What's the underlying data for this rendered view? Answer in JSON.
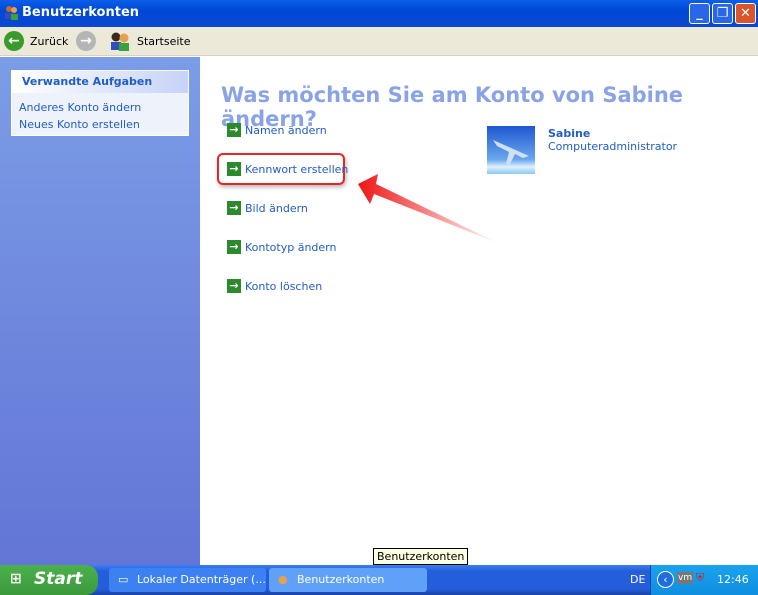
{
  "window": {
    "title": "Benutzerkonten",
    "icon": "user-accounts-icon"
  },
  "toolbar": {
    "back": "Zurück",
    "home": "Startseite"
  },
  "sidebar": {
    "heading": "Verwandte Aufgaben",
    "items": [
      {
        "label": "Anderes Konto ändern"
      },
      {
        "label": "Neues Konto erstellen"
      }
    ]
  },
  "main": {
    "title": "Was möchten Sie am Konto von Sabine ändern?",
    "tasks": [
      {
        "label": "Namen ändern"
      },
      {
        "label": "Kennwort erstellen"
      },
      {
        "label": "Bild ändern"
      },
      {
        "label": "Kontotyp ändern"
      },
      {
        "label": "Konto löschen"
      }
    ],
    "user": {
      "name": "Sabine",
      "type": "Computeradministrator"
    }
  },
  "tooltip": "Benutzerkonten",
  "taskbar": {
    "start": "Start",
    "buttons": [
      {
        "label": "Lokaler Datenträger (..."
      },
      {
        "label": "Benutzerkonten"
      }
    ],
    "lang": "DE",
    "clock": "12:46"
  },
  "colors": {
    "link": "#215dc6",
    "highlight": "#e8262a"
  }
}
